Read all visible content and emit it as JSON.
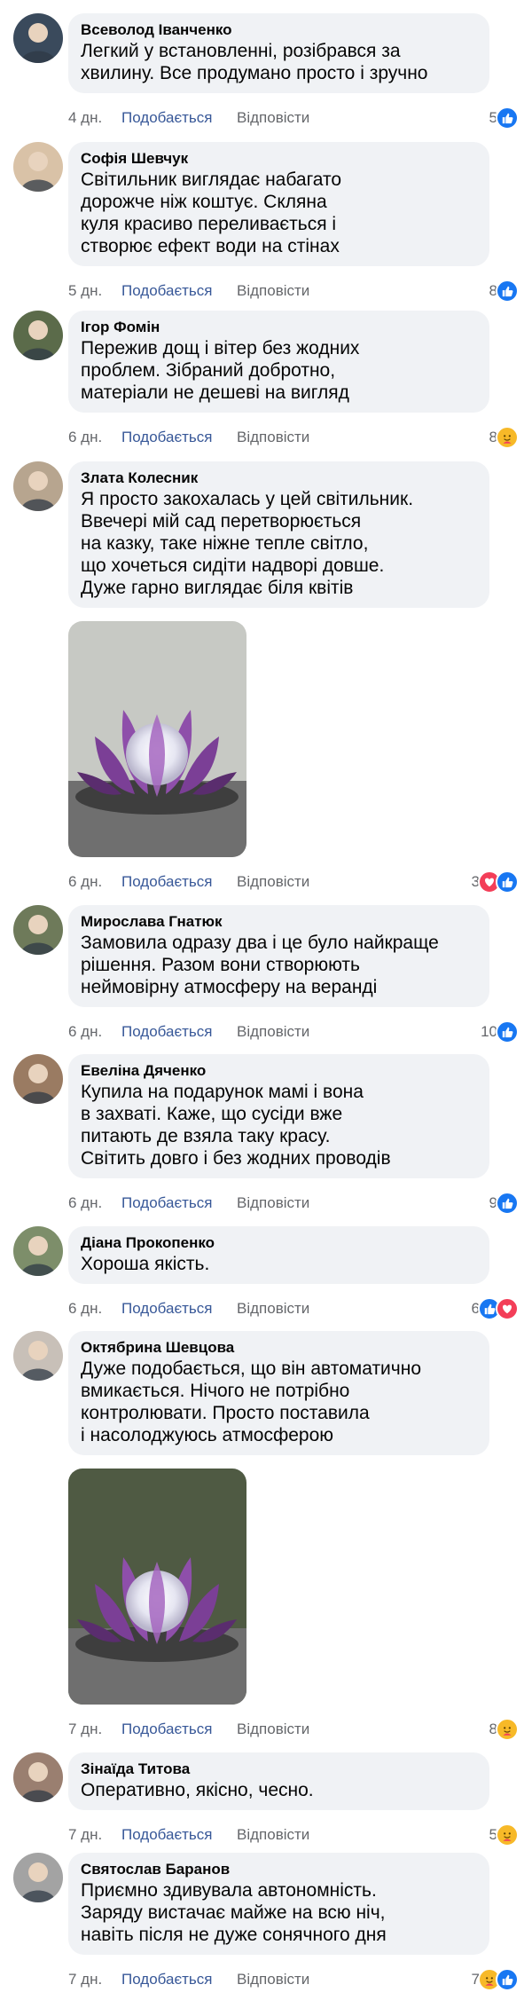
{
  "labels": {
    "like": "Подобається",
    "reply": "Відповісти"
  },
  "colors": {
    "bubble": "#f0f2f5",
    "link": "#385898",
    "meta": "#65676b",
    "like_icon": "#1877f2",
    "love_icon": "#f33e58",
    "care_icon": "#f7b928"
  },
  "comments": [
    {
      "author": "Всеволод Іванченко",
      "lines": [
        "Легкий у встановленні, розібрався за",
        "хвилину. Все продумано просто і зручно"
      ],
      "time": "4 дн.",
      "count": "5",
      "reactions": [
        "like-icon"
      ]
    },
    {
      "author": "Софія Шевчук",
      "lines": [
        "Світильник виглядає набагато",
        "дорожче ніж коштує. Скляна",
        "куля красиво переливається і",
        "створює ефект води на стінах"
      ],
      "time": "5 дн.",
      "count": "8",
      "reactions": [
        "like-icon"
      ]
    },
    {
      "author": "Ігор Фомін",
      "lines": [
        "Пережив дощ і вітер без жодних",
        "проблем. Зібраний добротно,",
        "матеріали не дешеві на вигляд"
      ],
      "time": "6 дн.",
      "count": "8",
      "reactions": [
        "care-icon"
      ]
    },
    {
      "author": "Злата Колесник",
      "lines": [
        "Я просто закохалась у цей світильник.",
        "Ввечері мій сад перетворюється",
        "на казку, таке ніжне тепле світло,",
        "що хочеться сидіти надворі довше.",
        "Дуже гарно виглядає біля квітів"
      ],
      "time": "6 дн.",
      "count": "3",
      "reactions": [
        "love-icon",
        "like-icon"
      ],
      "photo": true
    },
    {
      "author": "Мирослава Гнатюк",
      "lines": [
        "Замовила одразу два і це було найкраще",
        "рішення. Разом вони створюють",
        "неймовірну атмосферу на веранді"
      ],
      "time": "6 дн.",
      "count": "10",
      "reactions": [
        "like-icon"
      ]
    },
    {
      "author": "Евеліна Дяченко",
      "lines": [
        "Купила на подарунок мамі і вона",
        "в захваті. Каже, що сусіди вже",
        "питають де взяла таку красу.",
        "Світить довго і без жодних проводів"
      ],
      "time": "6 дн.",
      "count": "9",
      "reactions": [
        "like-icon"
      ]
    },
    {
      "author": "Діана Прокопенко",
      "lines": [
        "Хороша якість."
      ],
      "time": "6 дн.",
      "count": "6",
      "reactions": [
        "like-icon",
        "love-icon"
      ]
    },
    {
      "author": "Октябрина Шевцова",
      "lines": [
        "Дуже подобається, що він автоматично",
        "вмикається. Нічого не потрібно",
        "контролювати. Просто поставила",
        "і насолоджуюсь атмосферою"
      ],
      "time": "7 дн.",
      "count": "8",
      "reactions": [
        "care-icon"
      ],
      "photo": true
    },
    {
      "author": "Зінаїда Титова",
      "lines": [
        "Оперативно, якісно, чесно."
      ],
      "time": "7 дн.",
      "count": "5",
      "reactions": [
        "care-icon"
      ]
    },
    {
      "author": "Святослав Баранов",
      "lines": [
        "Приємно здивувала автономність.",
        "Заряду вистачає майже на всю ніч,",
        "навіть після не дуже сонячного дня"
      ],
      "time": "7 дн.",
      "count": "7",
      "reactions": [
        "care-icon",
        "like-icon"
      ]
    }
  ]
}
